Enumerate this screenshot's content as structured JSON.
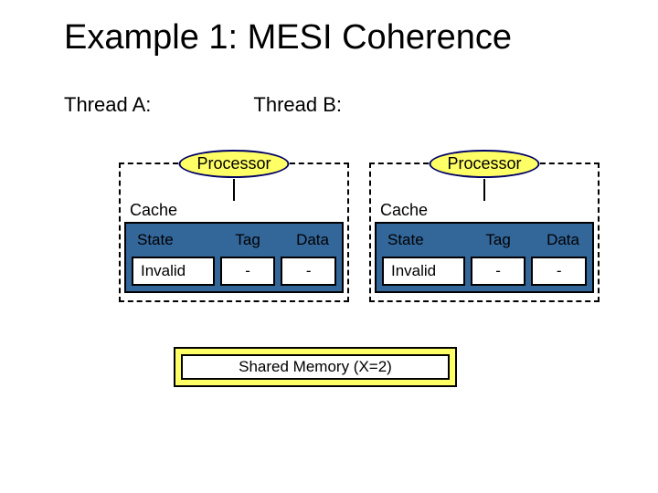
{
  "title": "Example 1: MESI Coherence",
  "threads": {
    "a_label": "Thread A:",
    "b_label": "Thread B:"
  },
  "core": {
    "processor_label": "Processor",
    "cache_label": "Cache",
    "headers": {
      "state": "State",
      "tag": "Tag",
      "data": "Data"
    }
  },
  "core_a": {
    "row": {
      "state": "Invalid",
      "tag": "-",
      "data": "-"
    }
  },
  "core_b": {
    "row": {
      "state": "Invalid",
      "tag": "-",
      "data": "-"
    }
  },
  "shared_memory": {
    "label": "Shared Memory (X=2)"
  }
}
